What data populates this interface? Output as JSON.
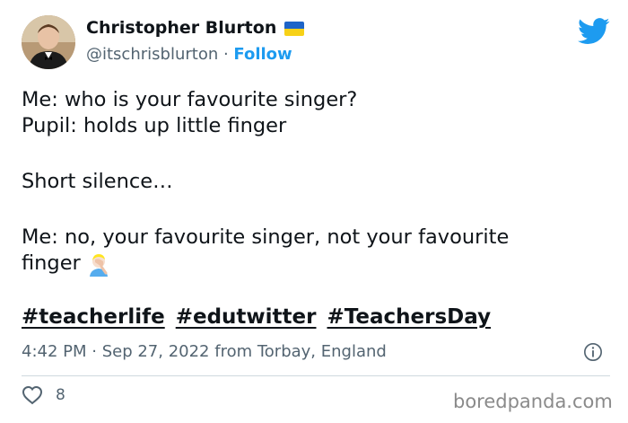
{
  "author": {
    "display_name": "Christopher Blurton",
    "handle": "@itschrisblurton",
    "separator": " · ",
    "follow_label": "Follow",
    "flag_colors": {
      "top": "#1e64c8",
      "bottom": "#f7d117"
    }
  },
  "tweet": {
    "lines": [
      "Me: who is your favourite singer?",
      "Pupil: holds up little finger",
      "",
      "Short silence…",
      "",
      "Me: no, your favourite singer, not your favourite",
      "finger"
    ],
    "emoji": "facepalm-emoji",
    "hashtags": [
      "#teacherlife",
      "#edutwitter",
      "#TeachersDay"
    ]
  },
  "meta": {
    "time": "4:42 PM",
    "separator": " · ",
    "date": "Sep 27, 2022",
    "source": " from Torbay, England"
  },
  "actions": {
    "like_count": "8"
  },
  "watermark": "boredpanda.com",
  "colors": {
    "accent": "#1d9bf0",
    "text": "#0f1419",
    "secondary": "#536471",
    "divider": "#cfd9de",
    "like_red": "#e0245e"
  }
}
